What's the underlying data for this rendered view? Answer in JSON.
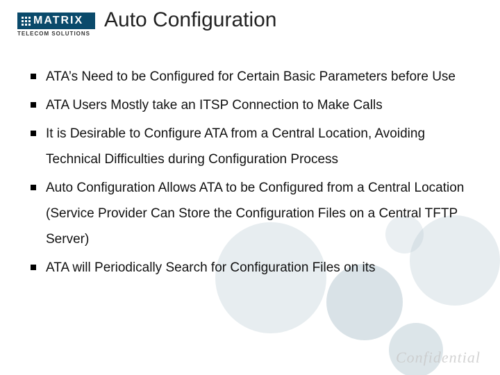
{
  "logo": {
    "brand": "MATRIX",
    "subline": "TELECOM SOLUTIONS"
  },
  "title": "Auto Configuration",
  "bullets": [
    "ATA’s Need to be Configured for Certain Basic Parameters before Use",
    "ATA Users Mostly take an ITSP Connection to Make Calls",
    "It is Desirable to Configure ATA from a Central Location, Avoiding Technical Difficulties during Configuration Process",
    "Auto Configuration Allows ATA to be Configured from a Central Location (Service Provider Can Store the Configuration Files on a Central TFTP Server)",
    "ATA  will Periodically Search for Configuration Files on its"
  ],
  "watermark": "Confidential"
}
